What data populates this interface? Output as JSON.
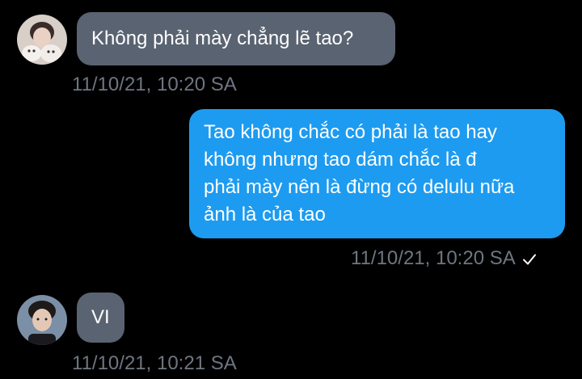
{
  "messages": [
    {
      "direction": "received",
      "lines": [
        "Không phải mày chẳng lẽ tao?"
      ],
      "timestamp": "11/10/21, 10:20 SA"
    },
    {
      "direction": "sent",
      "lines": [
        "Tao không chắc có phải là tao hay",
        "không nhưng tao dám chắc là đ",
        "phải mày nên là đừng có delulu nữa",
        "ảnh là của tao"
      ],
      "timestamp": "11/10/21, 10:20 SA",
      "read_icon": "check-icon"
    },
    {
      "direction": "received",
      "lines": [
        "VI"
      ],
      "timestamp": "11/10/21, 10:21 SA"
    }
  ],
  "colors": {
    "background": "#000000",
    "received_bubble": "#5a6371",
    "sent_bubble": "#1d9bf0",
    "timestamp": "#6e7681",
    "text": "#ffffff"
  }
}
